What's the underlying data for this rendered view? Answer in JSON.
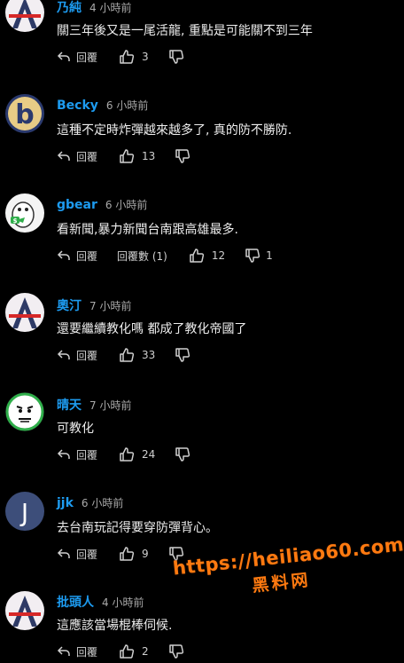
{
  "comments": [
    {
      "username": "乃純",
      "time": "4 小時前",
      "text": "關三年後又是一尾活龍, 重點是可能關不到三年",
      "reply_label": "回覆",
      "likes": "3",
      "replies_label": "",
      "dislikes": "",
      "avatar": "letter-a-avatar"
    },
    {
      "username": "Becky",
      "time": "6 小時前",
      "text": "這種不定時炸彈越來越多了, 真的防不勝防.",
      "reply_label": "回覆",
      "likes": "13",
      "replies_label": "",
      "dislikes": "",
      "avatar": "letter-b-avatar"
    },
    {
      "username": "gbear",
      "time": "6 小時前",
      "text": "看新聞,暴力新聞台南跟高雄最多.",
      "reply_label": "回覆",
      "likes": "12",
      "replies_label": "回覆數 (1)",
      "dislikes": "1",
      "avatar": "cartoon-bird-avatar"
    },
    {
      "username": "奧汀",
      "time": "7 小時前",
      "text": "還要繼續教化嗎 都成了教化帝國了",
      "reply_label": "回覆",
      "likes": "33",
      "replies_label": "",
      "dislikes": "",
      "avatar": "letter-a-avatar"
    },
    {
      "username": "晴天",
      "time": "7 小時前",
      "text": "可教化",
      "reply_label": "回覆",
      "likes": "24",
      "replies_label": "",
      "dislikes": "",
      "avatar": "rage-face-avatar"
    },
    {
      "username": "jjk",
      "time": "6 小時前",
      "text": "去台南玩記得要穿防彈背心。",
      "reply_label": "回覆",
      "likes": "9",
      "replies_label": "",
      "dislikes": "",
      "avatar": "letter-j-avatar"
    },
    {
      "username": "批頭人",
      "time": "4 小時前",
      "text": "這應該當場棍棒伺候.",
      "reply_label": "回覆",
      "likes": "2",
      "replies_label": "",
      "dislikes": "",
      "avatar": "letter-a-avatar"
    }
  ],
  "watermark": {
    "url": "https://heiliao60.com",
    "subtitle": "黑料网"
  },
  "colors": {
    "background": "#000000",
    "username": "#1d9bf0",
    "watermark": "#ff7a10"
  },
  "icons": {
    "reply": "reply-arrow-icon",
    "like": "thumbs-up-icon",
    "dislike": "thumbs-down-icon"
  }
}
